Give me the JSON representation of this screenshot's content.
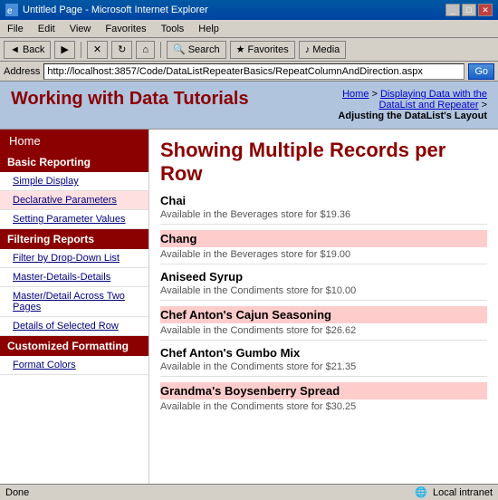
{
  "window": {
    "title": "Untitled Page - Microsoft Internet Explorer"
  },
  "menu": {
    "items": [
      "File",
      "Edit",
      "View",
      "Favorites",
      "Tools",
      "Help"
    ]
  },
  "toolbar": {
    "back": "◄ Back",
    "forward": "Forward ►",
    "stop": "✕",
    "refresh": "↻",
    "home": "⌂",
    "search": "Search",
    "favorites": "Favorites",
    "media": "Media"
  },
  "address": {
    "label": "Address",
    "url": "http://localhost:3857/Code/DataListRepeaterBasics/RepeatColumnAndDirection.aspx",
    "go": "Go"
  },
  "header": {
    "title": "Working with Data Tutorials",
    "breadcrumb": {
      "home": "Home",
      "sep1": " > ",
      "link1": "Displaying Data with the DataList and Repeater",
      "sep2": " > ",
      "current": "Adjusting the DataList's Layout"
    }
  },
  "sidebar": {
    "home": "Home",
    "sections": [
      {
        "label": "Basic Reporting",
        "items": [
          {
            "label": "Simple Display",
            "active": false
          },
          {
            "label": "Declarative Parameters",
            "active": true
          },
          {
            "label": "Setting Parameter Values",
            "active": false
          }
        ]
      },
      {
        "label": "Filtering Reports",
        "items": [
          {
            "label": "Filter by Drop-Down List",
            "active": false
          },
          {
            "label": "Master-Details-Details",
            "active": false
          },
          {
            "label": "Master/Detail Across Two Pages",
            "active": false
          },
          {
            "label": "Details of Selected Row",
            "active": false
          }
        ]
      },
      {
        "label": "Customized Formatting",
        "items": [
          {
            "label": "Format Colors",
            "active": false
          }
        ]
      }
    ]
  },
  "main": {
    "title": "Showing Multiple Records per Row",
    "products": [
      {
        "name": "Chai",
        "desc": "Available in the Beverages store for $19.36",
        "highlight": false
      },
      {
        "name": "Chang",
        "desc": "Available in the Beverages store for $19.00",
        "highlight": true
      },
      {
        "name": "Aniseed Syrup",
        "desc": "Available in the Condiments store for $10.00",
        "highlight": false
      },
      {
        "name": "Chef Anton's Cajun Seasoning",
        "desc": "Available in the Condiments store for $26.62",
        "highlight": true
      },
      {
        "name": "Chef Anton's Gumbo Mix",
        "desc": "Available in the Condiments store for $21.35",
        "highlight": false
      },
      {
        "name": "Grandma's Boysenberry Spread",
        "desc": "Available in the Condiments store for $30.25",
        "highlight": true
      }
    ]
  },
  "status": {
    "left": "Done",
    "right": "Local intranet"
  }
}
